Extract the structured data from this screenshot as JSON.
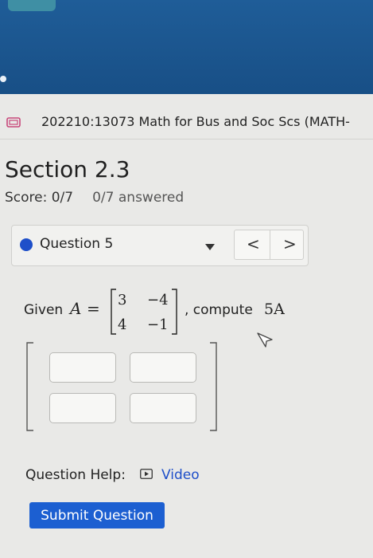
{
  "course": {
    "title": "202210:13073 Math for Bus and Soc Scs (MATH-"
  },
  "section": {
    "title": "Section 2.3",
    "score": "Score: 0/7",
    "answered": "0/7 answered"
  },
  "question_nav": {
    "label": "Question 5",
    "prev": "<",
    "next": ">"
  },
  "problem": {
    "given": "Given",
    "var": "A",
    "equals": "=",
    "matrix": [
      [
        "3",
        "−4"
      ],
      [
        "4",
        "−1"
      ]
    ],
    "compute_prefix": ", compute",
    "compute_expr": "5A"
  },
  "answer": {
    "cells": [
      [
        "",
        ""
      ],
      [
        "",
        ""
      ]
    ]
  },
  "help": {
    "label": "Question Help:",
    "video": "Video"
  },
  "submit": {
    "label": "Submit Question"
  },
  "colors": {
    "header": "#1f5d98",
    "accent": "#1e4fc9",
    "submit": "#1c5fd1",
    "background": "#e9e9e7"
  }
}
